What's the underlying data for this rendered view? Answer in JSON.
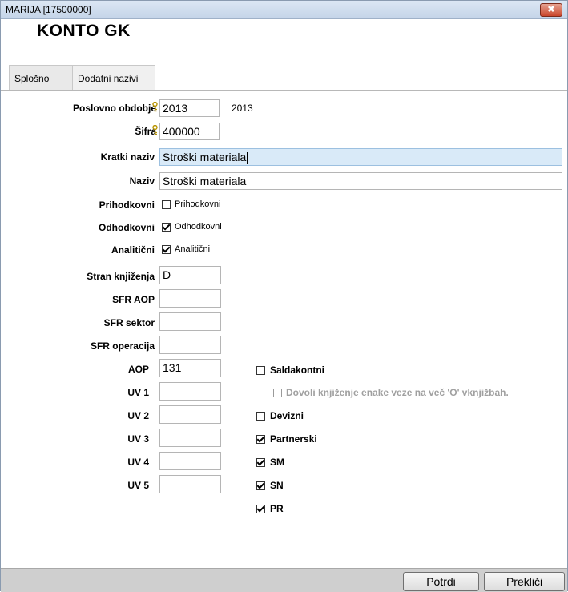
{
  "window": {
    "title": "MARIJA [17500000]",
    "close_glyph": "✖"
  },
  "heading": "KONTO GK",
  "tabs": [
    {
      "label": "Splošno",
      "active": true
    },
    {
      "label": "Dodatni nazivi",
      "active": false
    }
  ],
  "fields": {
    "poslovno_obdobje": {
      "label": "Poslovno obdobje",
      "value": "2013",
      "extra": "2013"
    },
    "sifra": {
      "label": "Šifra",
      "value": "400000"
    },
    "kratki_naziv": {
      "label": "Kratki naziv",
      "value": "Stroški materiala"
    },
    "naziv": {
      "label": "Naziv",
      "value": "Stroški materiala"
    },
    "prihodkovni": {
      "label": "Prihodkovni",
      "cb_label": "Prihodkovni",
      "checked": false
    },
    "odhodkovni": {
      "label": "Odhodkovni",
      "cb_label": "Odhodkovni",
      "checked": true
    },
    "analiticni": {
      "label": "Analitični",
      "cb_label": "Analitični",
      "checked": true
    },
    "stran_knjizenja": {
      "label": "Stran knjiženja",
      "value": "D"
    },
    "sfr_aop": {
      "label": "SFR AOP",
      "value": ""
    },
    "sfr_sektor": {
      "label": "SFR sektor",
      "value": ""
    },
    "sfr_operacija": {
      "label": "SFR operacija",
      "value": ""
    },
    "aop": {
      "label": "AOP",
      "value": "131"
    },
    "uv1": {
      "label": "UV 1",
      "value": ""
    },
    "uv2": {
      "label": "UV 2",
      "value": ""
    },
    "uv3": {
      "label": "UV 3",
      "value": ""
    },
    "uv4": {
      "label": "UV 4",
      "value": ""
    },
    "uv5": {
      "label": "UV 5",
      "value": ""
    }
  },
  "checks": {
    "saldakontni": {
      "label": "Saldakontni",
      "checked": false
    },
    "dovoli": {
      "label": "Dovoli knjiženje enake veze na več 'O' vknjižbah.",
      "checked": false,
      "disabled": true
    },
    "devizni": {
      "label": "Devizni",
      "checked": false
    },
    "partnerski": {
      "label": "Partnerski",
      "checked": true
    },
    "sm": {
      "label": "SM",
      "checked": true
    },
    "sn": {
      "label": "SN",
      "checked": true
    },
    "pr": {
      "label": "PR",
      "checked": true
    }
  },
  "buttons": {
    "potrdi": "Potrdi",
    "preklici": "Prekliči"
  },
  "colors": {
    "title_bg": "#c4d4e8",
    "highlight_field": "#d9eaf8",
    "footer_bg": "#cfcfcf",
    "close_red": "#c9462c"
  },
  "icons": {
    "key": "key-icon",
    "close": "close-icon",
    "check": "checkmark"
  }
}
